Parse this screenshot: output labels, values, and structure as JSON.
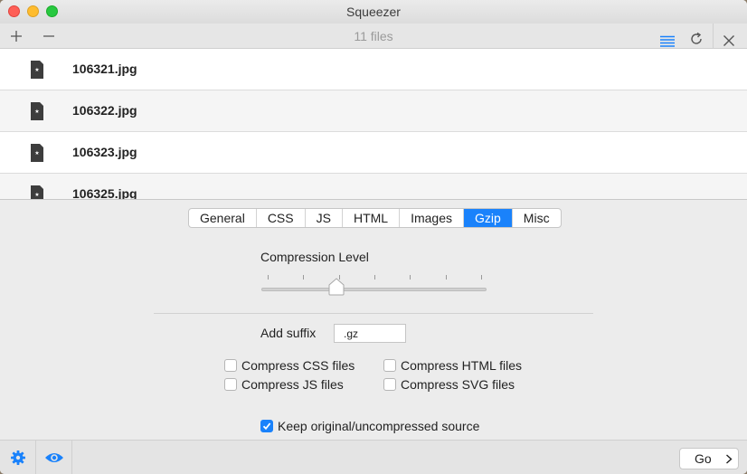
{
  "window": {
    "title": "Squeezer"
  },
  "toolbar": {
    "add_icon": "plus-icon",
    "remove_icon": "minus-icon",
    "file_count": "11 files",
    "list_icon": "list-icon",
    "refresh_icon": "refresh-icon",
    "close_icon": "close-icon"
  },
  "files": [
    {
      "name": "106321.jpg"
    },
    {
      "name": "106322.jpg"
    },
    {
      "name": "106323.jpg"
    },
    {
      "name": "106325.jpg"
    }
  ],
  "tabs": [
    {
      "label": "General"
    },
    {
      "label": "CSS"
    },
    {
      "label": "JS"
    },
    {
      "label": "HTML"
    },
    {
      "label": "Images"
    },
    {
      "label": "Gzip",
      "active": true
    },
    {
      "label": "Misc"
    }
  ],
  "gzip": {
    "compression_label": "Compression Level",
    "compression_level": 3,
    "compression_max": 9,
    "suffix_label": "Add suffix",
    "suffix_value": ".gz",
    "options": [
      {
        "label": "Compress CSS files",
        "checked": false
      },
      {
        "label": "Compress HTML files",
        "checked": false
      },
      {
        "label": "Compress JS files",
        "checked": false
      },
      {
        "label": "Compress SVG files",
        "checked": false
      }
    ],
    "keep_original": {
      "label": "Keep original/uncompressed source",
      "checked": true
    }
  },
  "bottombar": {
    "settings_icon": "gear-icon",
    "preview_icon": "eye-icon",
    "go_label": "Go"
  },
  "colors": {
    "accent": "#1a82fb"
  }
}
